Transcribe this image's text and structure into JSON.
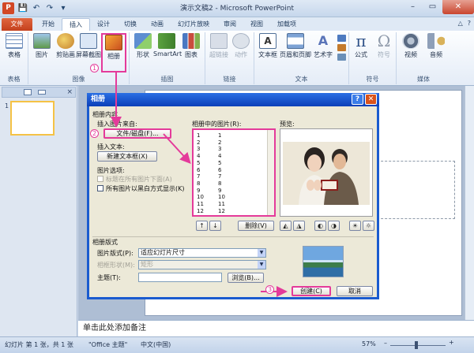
{
  "window": {
    "title": "演示文稿2 - Microsoft PowerPoint",
    "app_logo": "P"
  },
  "qat": {
    "save": "💾",
    "undo": "↶",
    "redo": "↷",
    "customize": "▾"
  },
  "window_controls": {
    "minimize": "–",
    "maximize": "▭",
    "close": "✕"
  },
  "tabs": {
    "file": "文件",
    "items": [
      "开始",
      "插入",
      "设计",
      "切换",
      "动画",
      "幻灯片放映",
      "审阅",
      "视图",
      "加载项"
    ],
    "active": "插入"
  },
  "tab_right": {
    "minimize_ribbon": "△",
    "help": "?"
  },
  "ribbon": {
    "groups": {
      "tables": {
        "label": "表格",
        "buttons": [
          "表格"
        ]
      },
      "images": {
        "label": "图像",
        "buttons": [
          "图片",
          "剪贴画",
          "屏幕截图",
          "相册"
        ]
      },
      "illustrations": {
        "label": "插图",
        "buttons": [
          "形状",
          "SmartArt",
          "图表"
        ]
      },
      "links": {
        "label": "链接",
        "buttons": [
          "超链接",
          "动作"
        ]
      },
      "text": {
        "label": "文本",
        "buttons": [
          "文本框",
          "页眉和页脚",
          "艺术字"
        ]
      },
      "symbols": {
        "label": "符号",
        "buttons": [
          "公式",
          "符号"
        ]
      },
      "media": {
        "label": "媒体",
        "buttons": [
          "视频",
          "音频"
        ]
      }
    }
  },
  "left_panel": {
    "close": "×",
    "slide_number": "1"
  },
  "notes": {
    "placeholder": "单击此处添加备注"
  },
  "status_bar": {
    "slide_info": "幻灯片 第 1 张，共 1 张",
    "theme": "\"Office 主题\"",
    "language": "中文(中国)",
    "zoom": "57%",
    "zoom_out": "–",
    "zoom_in": "+"
  },
  "dialog": {
    "title": "相册",
    "help": "?",
    "close": "✕",
    "content_group": "相册内容",
    "insert_from": "插入图片来自:",
    "file_disk_button": "文件/磁盘(F)...",
    "insert_text": "插入文本:",
    "new_textbox_button": "新建文本框(X)",
    "picture_options": "图片选项:",
    "captions_below": "标题在所有图片下面(A)",
    "all_black_white": "所有图片以黑白方式显示(K)",
    "pictures_in_album": "相册中的图片(R):",
    "list_rows": [
      {
        "index": "1",
        "name": "1"
      },
      {
        "index": "2",
        "name": "2"
      },
      {
        "index": "3",
        "name": "3"
      },
      {
        "index": "4",
        "name": "4"
      },
      {
        "index": "5",
        "name": "5"
      },
      {
        "index": "6",
        "name": "6"
      },
      {
        "index": "7",
        "name": "7"
      },
      {
        "index": "8",
        "name": "8"
      },
      {
        "index": "9",
        "name": "9"
      },
      {
        "index": "10",
        "name": "10"
      },
      {
        "index": "11",
        "name": "11"
      },
      {
        "index": "12",
        "name": "12"
      }
    ],
    "preview": "预览:",
    "move_up": "↑",
    "move_down": "↓",
    "remove_button": "删除(V)",
    "layout_group": "相册版式",
    "picture_layout_label": "图片版式(P):",
    "picture_layout_value": "适应幻灯片尺寸",
    "frame_shape_label": "相框形状(M):",
    "frame_shape_value": "矩形",
    "theme_label": "主题(T):",
    "theme_value": "",
    "browse_button": "浏览(B)...",
    "create_button": "创建(C)",
    "cancel_button": "取消"
  },
  "annotations": {
    "step1": "1",
    "step2": "2",
    "step3": "3"
  },
  "colors": {
    "highlight": "#e43a9a",
    "file_tab": "#c4401d",
    "dialog_title": "#0b3fb8"
  }
}
